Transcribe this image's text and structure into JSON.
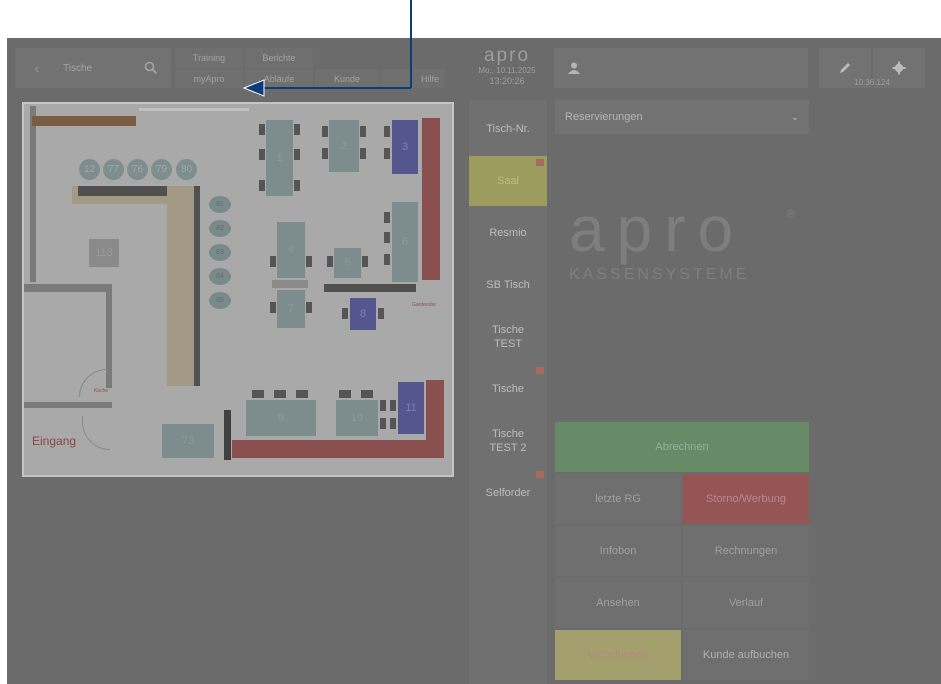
{
  "header": {
    "back_icon": "chevron-left-icon",
    "section_label": "Tische",
    "search_icon": "search-icon",
    "nav_tabs": [
      "Training",
      "Berichte",
      "myApro",
      "Abläufe",
      "Kunde",
      "Hilfe"
    ],
    "brand_logo": "apro",
    "datetime_line1": "Mo., 10.11.2025",
    "datetime_line2": "13:20:26",
    "user_icon": "user-icon",
    "edit_icon": "pencil-icon",
    "settings_icon": "gear-icon",
    "ip_text": "10.36.124"
  },
  "floorplan": {
    "tables": [
      {
        "num": "1",
        "color": "teal"
      },
      {
        "num": "2",
        "color": "teal"
      },
      {
        "num": "3",
        "color": "blue"
      },
      {
        "num": "4",
        "color": "teal"
      },
      {
        "num": "5",
        "color": "teal"
      },
      {
        "num": "6",
        "color": "teal"
      },
      {
        "num": "7",
        "color": "teal"
      },
      {
        "num": "8",
        "color": "blue"
      },
      {
        "num": "9",
        "color": "teal"
      },
      {
        "num": "10",
        "color": "teal"
      },
      {
        "num": "11",
        "color": "blue"
      },
      {
        "num": "73",
        "color": "teal"
      },
      {
        "num": "118",
        "color": "teal"
      }
    ],
    "round_tables": [
      "12",
      "77",
      "76",
      "79",
      "80"
    ],
    "oval_tables": [
      "81",
      "82",
      "83",
      "84",
      "85"
    ],
    "label_kueche": "Küche",
    "label_garderobe": "Garderobe",
    "label_eingang": "Eingang"
  },
  "side_nav": [
    {
      "label": "Tisch-Nr.",
      "badge": false
    },
    {
      "label": "Saal",
      "badge": true
    },
    {
      "label": "Resmio",
      "badge": false
    },
    {
      "label": "SB Tisch",
      "badge": false
    },
    {
      "label": "Tische TEST",
      "badge": false
    },
    {
      "label": "Tische",
      "badge": true
    },
    {
      "label": "Tische TEST 2",
      "badge": false
    },
    {
      "label": "Selforder",
      "badge": true
    }
  ],
  "reservations": {
    "dropdown_label": "Reservierungen",
    "dropdown_icon": "chevron-down-icon"
  },
  "brand": {
    "logo_text": "apro",
    "tagline": "KASSENSYSTEME",
    "registered": "®"
  },
  "actions": {
    "abrechnen": "Abrechnen",
    "letzte_rg": "letzte RG",
    "storno": "Storno/Werbung",
    "infobon": "Infobon",
    "rechnungen": "Rechnungen",
    "ansehen": "Ansehen",
    "verlauf": "Verlauf",
    "verschieben": "Verschieben",
    "kunde_aufbuchen": "Kunde aufbuchen"
  },
  "colors": {
    "overlay": "#6b6b6b",
    "saal_active": "#9c9c5e",
    "abrechnen_green": "#678a67",
    "storno_red": "#955555",
    "verschieben_yellow": "#a3a06e",
    "table_blue": "#56568e",
    "annotation_blue": "#0a3d7a"
  }
}
